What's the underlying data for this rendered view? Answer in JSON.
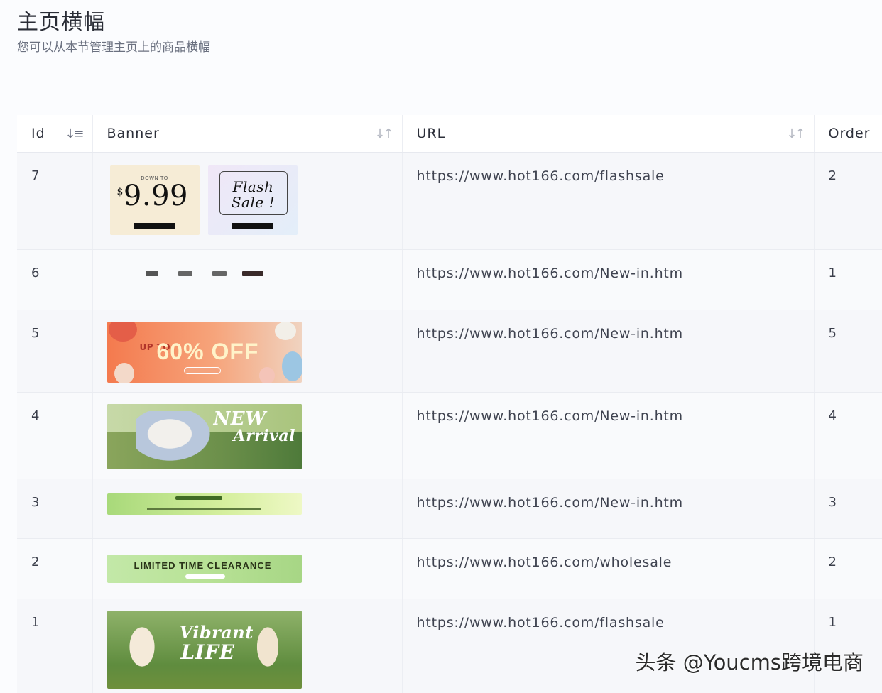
{
  "header": {
    "title": "主页横幅",
    "subtitle": "您可以从本节管理主页上的商品横幅"
  },
  "table": {
    "columns": [
      {
        "key": "id",
        "label": "Id",
        "sortable": true,
        "sort_active": true
      },
      {
        "key": "banner",
        "label": "Banner",
        "sortable": true,
        "sort_active": false
      },
      {
        "key": "url",
        "label": "URL",
        "sortable": true,
        "sort_active": false
      },
      {
        "key": "order",
        "label": "Order",
        "sortable": false,
        "sort_active": false
      }
    ],
    "rows": [
      {
        "id": "7",
        "banner": "price-and-flash-sale",
        "url": "https://www.hot166.com/flashsale",
        "order": "2"
      },
      {
        "id": "6",
        "banner": "small-thumbnails",
        "url": "https://www.hot166.com/New-in.htm",
        "order": "1"
      },
      {
        "id": "5",
        "banner": "up-to-60-off",
        "url": "https://www.hot166.com/New-in.htm",
        "order": "5"
      },
      {
        "id": "4",
        "banner": "new-arrival",
        "url": "https://www.hot166.com/New-in.htm",
        "order": "4"
      },
      {
        "id": "3",
        "banner": "green-strip",
        "url": "https://www.hot166.com/New-in.htm",
        "order": "3"
      },
      {
        "id": "2",
        "banner": "limited-time-clearance",
        "url": "https://www.hot166.com/wholesale",
        "order": "2"
      },
      {
        "id": "1",
        "banner": "vibrant-life",
        "url": "https://www.hot166.com/flashsale",
        "order": "1"
      }
    ]
  },
  "banners": {
    "row7": {
      "card_a": {
        "top_text": "DOWN TO",
        "price_symbol": "$",
        "price": "9.99"
      },
      "card_b": {
        "line1": "Flash",
        "line2": "Sale !"
      }
    },
    "row5": {
      "upto": "UP TO",
      "headline": "60% OFF"
    },
    "row4": {
      "line1": "NEW",
      "line2": "Arrival"
    },
    "row2": {
      "headline": "LIMITED TIME CLEARANCE"
    },
    "row1": {
      "line1": "Vibrant",
      "line2": "LIFE"
    }
  },
  "icons": {
    "sort_active": "sort-descending-icon",
    "sort_inactive": "sort-icon"
  },
  "colors": {
    "background": "#fbfcfe",
    "row_odd": "#f6f7fa",
    "row_even": "#f9fafc",
    "header_bg": "#ffffff",
    "text": "#2c2f3a"
  },
  "watermark": "头条 @Youcms跨境电商"
}
